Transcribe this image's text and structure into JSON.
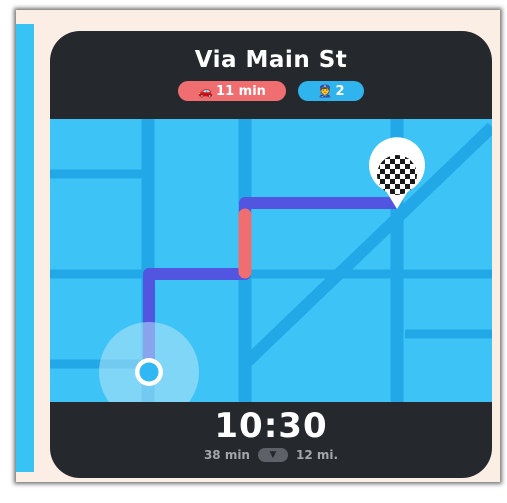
{
  "route": {
    "title": "Via Main St",
    "traffic_badge": "11 min",
    "police_badge": "2"
  },
  "eta": {
    "arrival_time": "10:30",
    "duration": "38 min",
    "distance": "12 mi."
  },
  "icons": {
    "traffic": "car-icon",
    "police": "police-officer-icon",
    "destination": "checkered-flag-icon",
    "current_location": "location-dot-icon",
    "expand": "chevron-down-icon"
  },
  "colors": {
    "map_background": "#3ec3f7",
    "road": "#22a8e6",
    "route": "#5155e0",
    "traffic_segment": "#f06e70",
    "panel": "#25282d",
    "frame": "#fbeee5"
  }
}
